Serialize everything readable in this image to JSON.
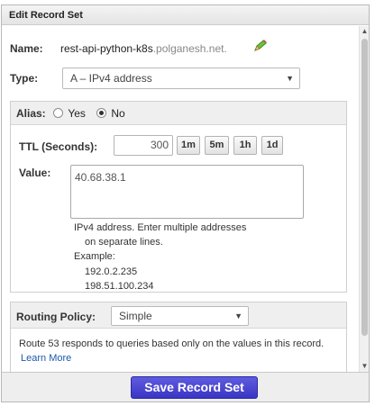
{
  "panel": {
    "title": "Edit Record Set"
  },
  "name": {
    "label": "Name:",
    "value": "rest-api-python-k8s",
    "domain": ".polganesh.net."
  },
  "type": {
    "label": "Type:",
    "selected": "A – IPv4 address"
  },
  "alias": {
    "label": "Alias:",
    "yes_label": "Yes",
    "no_label": "No",
    "selected": "No"
  },
  "ttl": {
    "label": "TTL (Seconds):",
    "value": "300",
    "presets": [
      "1m",
      "5m",
      "1h",
      "1d"
    ]
  },
  "value": {
    "label": "Value:",
    "text": "40.68.38.1",
    "hint_line1": "IPv4 address. Enter multiple addresses",
    "hint_line2": "on separate lines.",
    "example_label": "Example:",
    "example_1": "192.0.2.235",
    "example_2": "198.51.100.234"
  },
  "routing": {
    "label": "Routing Policy:",
    "selected": "Simple",
    "description": "Route 53 responds to queries based only on the values in this record.",
    "learn_more": "Learn More"
  },
  "footer": {
    "save_label": "Save Record Set"
  },
  "colors": {
    "save_button": "#4440d0",
    "link": "#1a5aab",
    "pencil": "#5cb82a"
  },
  "icons": {
    "edit": "pencil-icon",
    "dropdown": "chevron-down-icon"
  }
}
